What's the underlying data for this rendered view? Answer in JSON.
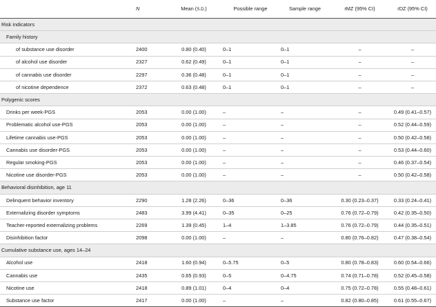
{
  "header": {
    "col_label": "",
    "col_n": "N",
    "col_mean": "Mean (",
    "col_mean_sd": "S.D.",
    "col_mean_close": ")",
    "col_possible": "Possible range",
    "col_sample": "Sample range",
    "col_rmz": "rMZ (95% CI)",
    "col_rdz": "rDZ (95% CI)"
  },
  "rows": [
    {
      "kind": "section",
      "label": "Risk indicators"
    },
    {
      "kind": "subsection",
      "label": "Family history"
    },
    {
      "kind": "data",
      "indent": 2,
      "label": "of substance use disorder",
      "n": "2400",
      "mean": "0.80 (0.40)",
      "possible": "0–1",
      "sample": "0–1",
      "rmz": "–",
      "rdz": "–"
    },
    {
      "kind": "data",
      "indent": 2,
      "label": "of alcohol use disorder",
      "n": "2327",
      "mean": "0.62 (0.49)",
      "possible": "0–1",
      "sample": "0–1",
      "rmz": "–",
      "rdz": "–"
    },
    {
      "kind": "data",
      "indent": 2,
      "label": "of cannabis use disorder",
      "n": "2297",
      "mean": "0.36 (0.48)",
      "possible": "0–1",
      "sample": "0–1",
      "rmz": "–",
      "rdz": "–"
    },
    {
      "kind": "data",
      "indent": 2,
      "label": "of nicotine dependence",
      "n": "2372",
      "mean": "0.63 (0.48)",
      "possible": "0–1",
      "sample": "0–1",
      "rmz": "–",
      "rdz": "–"
    },
    {
      "kind": "section",
      "label": "Polygenic scores"
    },
    {
      "kind": "data",
      "indent": 1,
      "label": "Drinks per week-PGS",
      "n": "2053",
      "mean": "0.00 (1.00)",
      "possible": "–",
      "sample": "–",
      "rmz": "–",
      "rdz": "0.49 (0.41–0.57)"
    },
    {
      "kind": "data",
      "indent": 1,
      "label": "Problematic alcohol use-PGS",
      "n": "2053",
      "mean": "0.00 (1.00)",
      "possible": "–",
      "sample": "–",
      "rmz": "–",
      "rdz": "0.52 (0.44–0.59)"
    },
    {
      "kind": "data",
      "indent": 1,
      "label": "Lifetime cannabis use-PGS",
      "n": "2053",
      "mean": "0.00 (1.00)",
      "possible": "–",
      "sample": "–",
      "rmz": "–",
      "rdz": "0.50 (0.42–0.58)"
    },
    {
      "kind": "data",
      "indent": 1,
      "label": "Cannabis use disorder-PGS",
      "n": "2053",
      "mean": "0.00 (1.00)",
      "possible": "–",
      "sample": "–",
      "rmz": "–",
      "rdz": "0.53 (0.44–0.60)"
    },
    {
      "kind": "data",
      "indent": 1,
      "label": "Regular smoking-PGS",
      "n": "2053",
      "mean": "0.00 (1.00)",
      "possible": "–",
      "sample": "–",
      "rmz": "–",
      "rdz": "0.46 (0.37–0.54)"
    },
    {
      "kind": "data",
      "indent": 1,
      "label": "Nicotine use disorder-PGS",
      "n": "2053",
      "mean": "0.00 (1.00)",
      "possible": "–",
      "sample": "–",
      "rmz": "–",
      "rdz": "0.50 (0.42–0.58)"
    },
    {
      "kind": "section",
      "label": "Behavioral disinhibition, age 11"
    },
    {
      "kind": "data",
      "indent": 1,
      "label": "Delinquent behavior inventory",
      "n": "2290",
      "mean": "1.28 (2.26)",
      "possible": "0–36",
      "sample": "0–36",
      "rmz": "0.30 (0.23–0.37)",
      "rdz": "0.33 (0.24–0.41)"
    },
    {
      "kind": "data",
      "indent": 1,
      "label": "Externalizing disorder symptoms",
      "n": "2483",
      "mean": "3.99 (4.41)",
      "possible": "0–35",
      "sample": "0–25",
      "rmz": "0.76 (0.72–0.79)",
      "rdz": "0.42 (0.35–0.50)"
    },
    {
      "kind": "data",
      "indent": 1,
      "label": "Teacher-reported externalizing problems",
      "n": "2269",
      "mean": "1.39 (0.45)",
      "possible": "1–4",
      "sample": "1–3.85",
      "rmz": "0.76 (0.72–0.79)",
      "rdz": "0.44 (0.35–0.51)"
    },
    {
      "kind": "data",
      "indent": 1,
      "label": "Disinhibition factor",
      "n": "2098",
      "mean": "0.00 (1.00)",
      "possible": "–",
      "sample": "–",
      "rmz": "0.80 (0.76–0.82)",
      "rdz": "0.47 (0.38–0.54)"
    },
    {
      "kind": "section",
      "label": "Cumulative substance use, ages 14–24"
    },
    {
      "kind": "data",
      "indent": 1,
      "label": "Alcohol use",
      "n": "2418",
      "mean": "1.60 (0.94)",
      "possible": "0–5.75",
      "sample": "0–5",
      "rmz": "0.80 (0.78–0.83)",
      "rdz": "0.60 (0.54–0.66)"
    },
    {
      "kind": "data",
      "indent": 1,
      "label": "Cannabis use",
      "n": "2435",
      "mean": "0.65 (0.93)",
      "possible": "0–5",
      "sample": "0–4.75",
      "rmz": "0.74 (0.71–0.78)",
      "rdz": "0.52 (0.45–0.58)"
    },
    {
      "kind": "data",
      "indent": 1,
      "label": "Nicotine use",
      "n": "2418",
      "mean": "0.89 (1.01)",
      "possible": "0–4",
      "sample": "0–4",
      "rmz": "0.75 (0.72–0.78)",
      "rdz": "0.55 (0.48–0.61)"
    },
    {
      "kind": "data",
      "indent": 1,
      "label": "Substance use factor",
      "n": "2417",
      "mean": "0.00 (1.00)",
      "possible": "–",
      "sample": "–",
      "rmz": "0.82 (0.80–0.85)",
      "rdz": "0.61 (0.55–0.67)"
    }
  ]
}
